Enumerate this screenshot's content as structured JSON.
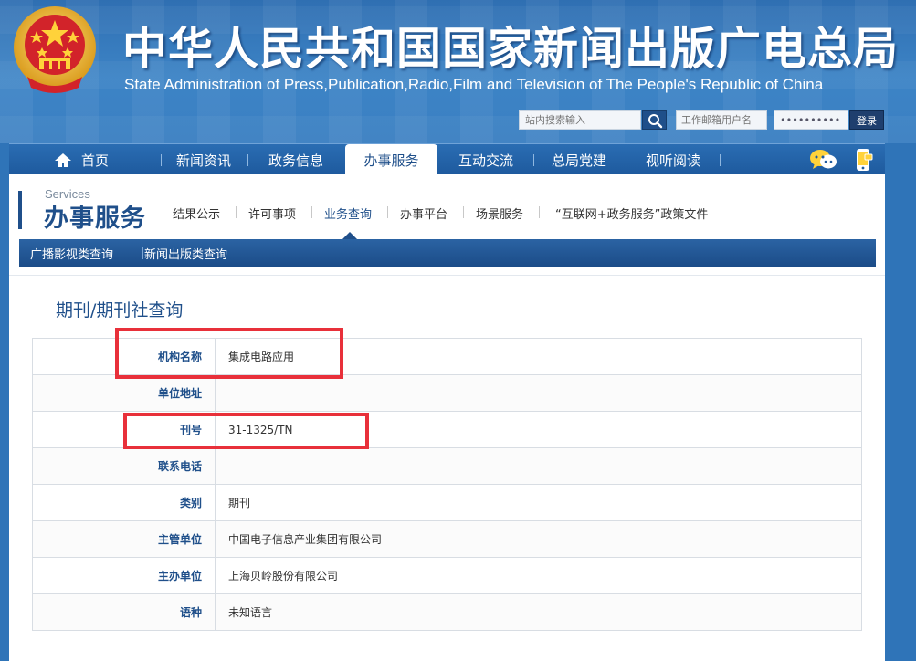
{
  "header": {
    "title_cn": "中华人民共和国国家新闻出版广电总局",
    "title_en": "State Administration of Press,Publication,Radio,Film and Television of The People's Republic of China",
    "search_placeholder": "站内搜索输入",
    "mail_user_placeholder": "工作邮箱用户名",
    "mail_password_mask": "••••••••••",
    "login_label": "登录"
  },
  "nav": {
    "items": [
      "首页",
      "新闻资讯",
      "政务信息",
      "办事服务",
      "互动交流",
      "总局党建",
      "视听阅读"
    ],
    "active": "办事服务"
  },
  "section": {
    "title_en": "Services",
    "title_cn": "办事服务",
    "sub_items": [
      "结果公示",
      "许可事项",
      "业务查询",
      "办事平台",
      "场景服务",
      "“互联网+政务服务”政策文件"
    ],
    "active_sub": "业务查询",
    "categories": [
      "广播影视类查询",
      "新闻出版类查询"
    ]
  },
  "page": {
    "title": "期刊/期刊社查询",
    "rows": [
      {
        "label": "机构名称",
        "value": "集成电路应用"
      },
      {
        "label": "单位地址",
        "value": ""
      },
      {
        "label": "刊号",
        "value": "31-1325/TN"
      },
      {
        "label": "联系电话",
        "value": ""
      },
      {
        "label": "类别",
        "value": "期刊"
      },
      {
        "label": "主管单位",
        "value": "中国电子信息产业集团有限公司"
      },
      {
        "label": "主办单位",
        "value": "上海贝岭股份有限公司"
      },
      {
        "label": "语种",
        "value": "未知语言"
      }
    ]
  },
  "colors": {
    "brand_blue": "#1f4f8a",
    "highlight_red": "#e8303a",
    "banner_blue": "#3d84c6"
  },
  "icons": [
    "national-emblem",
    "home-icon",
    "search-icon",
    "chat-icon",
    "phone-icon"
  ]
}
